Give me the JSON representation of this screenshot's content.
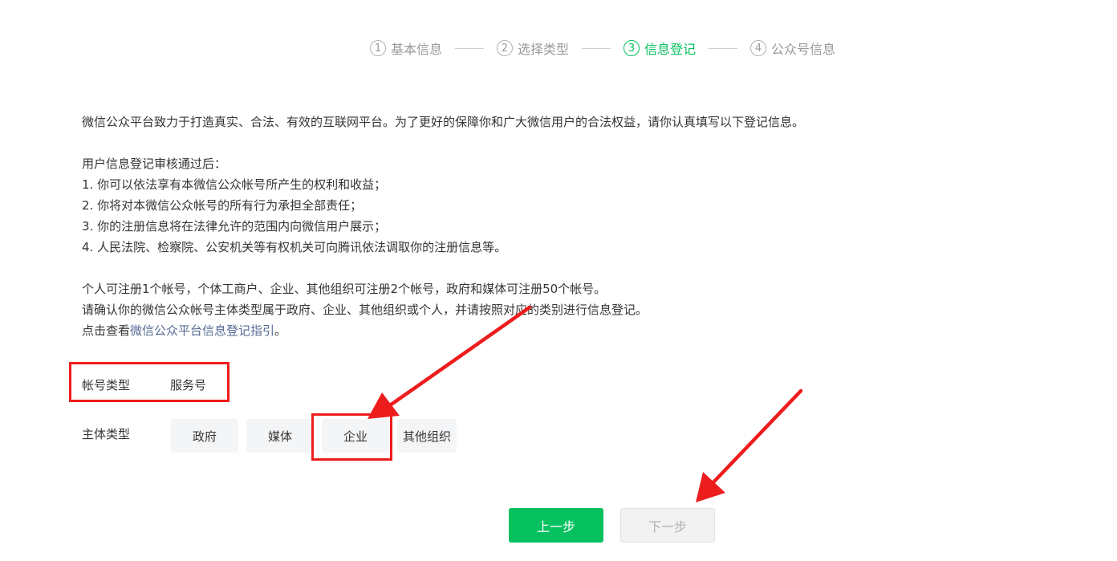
{
  "steps": [
    {
      "num": "1",
      "label": "基本信息"
    },
    {
      "num": "2",
      "label": "选择类型"
    },
    {
      "num": "3",
      "label": "信息登记"
    },
    {
      "num": "4",
      "label": "公众号信息"
    }
  ],
  "intro": {
    "line1": "微信公众平台致力于打造真实、合法、有效的互联网平台。为了更好的保障你和广大微信用户的合法权益，请你认真填写以下登记信息。",
    "after_title": "用户信息登记审核通过后：",
    "items": [
      "1. 你可以依法享有本微信公众帐号所产生的权利和收益；",
      "2. 你将对本微信公众帐号的所有行为承担全部责任；",
      "3. 你的注册信息将在法律允许的范围内向微信用户展示；",
      "4. 人民法院、检察院、公安机关等有权机关可向腾讯依法调取你的注册信息等。"
    ],
    "limits": "个人可注册1个帐号，个体工商户、企业、其他组织可注册2个帐号，政府和媒体可注册50个帐号。",
    "confirm": "请确认你的微信公众帐号主体类型属于政府、企业、其他组织或个人，并请按照对应的类别进行信息登记。",
    "guide_prefix": "点击查看",
    "guide_link": "微信公众平台信息登记指引",
    "guide_suffix": "。"
  },
  "form": {
    "account_type_label": "帐号类型",
    "account_type_value": "服务号",
    "subject_type_label": "主体类型",
    "subject_options": [
      "政府",
      "媒体",
      "企业",
      "其他组织"
    ]
  },
  "buttons": {
    "prev": "上一步",
    "next": "下一步"
  },
  "colors": {
    "accent": "#07c160",
    "link": "#576b95",
    "annotation": "#ee1d1d"
  }
}
